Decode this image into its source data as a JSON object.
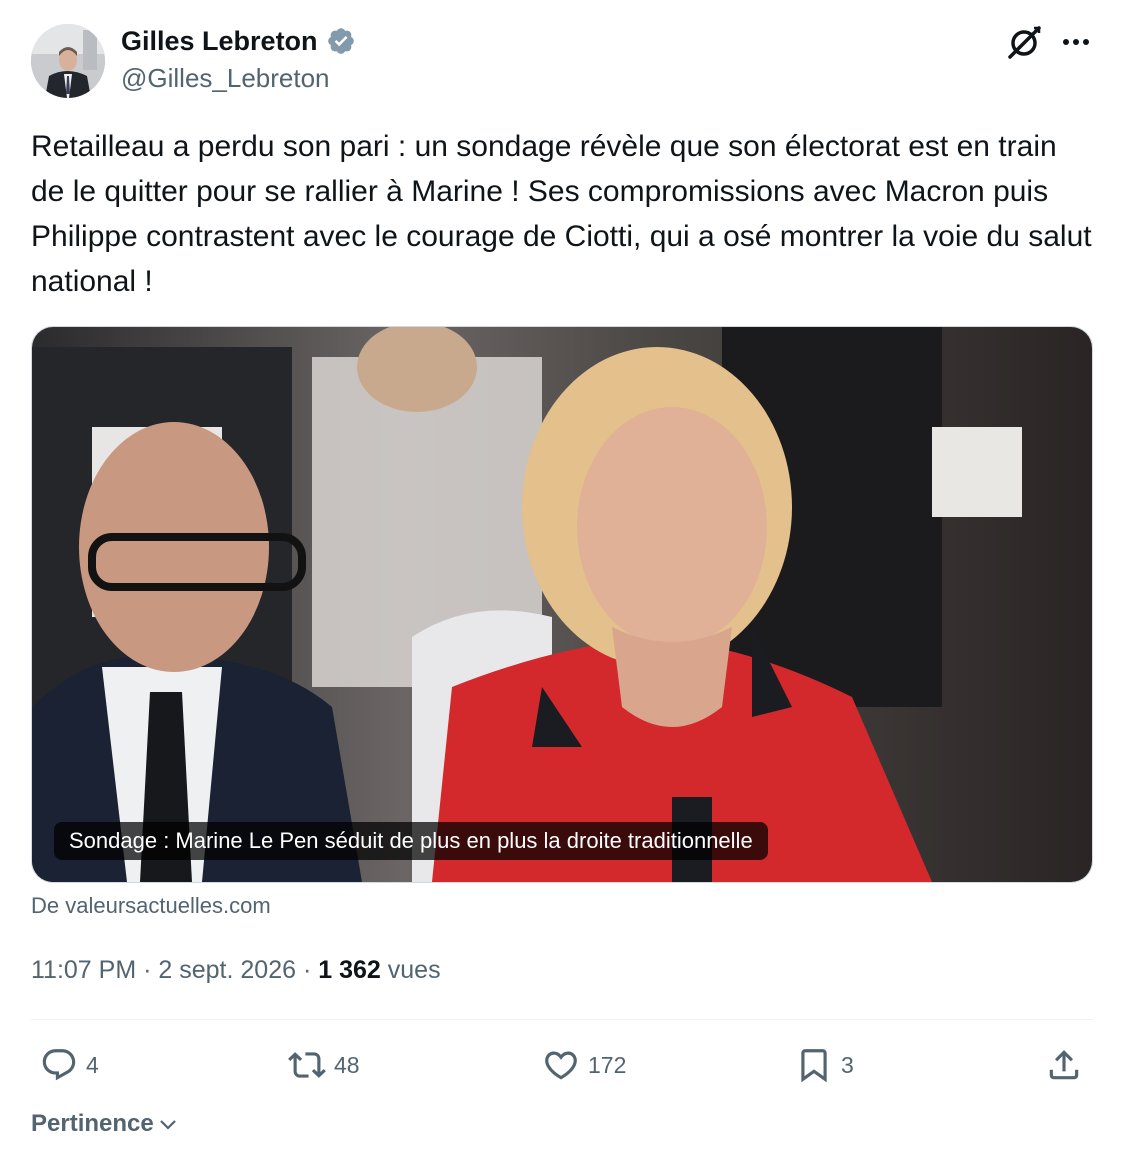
{
  "author": {
    "name": "Gilles Lebreton",
    "handle": "@Gilles_Lebreton"
  },
  "tweet": {
    "text": "Retailleau a perdu son pari : un sondage révèle que son électorat est en train de le quitter pour se rallier à Marine ! Ses compromissions avec Macron puis Philippe contrastent avec le courage de Ciotti, qui a osé montrer la voie du salut national !"
  },
  "card": {
    "caption": "Sondage : Marine Le Pen séduit de plus en plus la droite traditionnelle",
    "source": "De valeursactuelles.com"
  },
  "meta": {
    "time": "11:07 PM",
    "date": "2 sept. 2026",
    "views_count": "1 362",
    "views_label": "vues",
    "separator": "·"
  },
  "actions": {
    "replies": "4",
    "reposts": "48",
    "likes": "172",
    "bookmarks": "3"
  },
  "sort": {
    "label": "Pertinence"
  },
  "colors": {
    "verified": "#829aab",
    "secondary_text": "#536471",
    "primary_text": "#0f1419",
    "divider": "#eff3f4"
  },
  "icons": [
    "verified-badge-icon",
    "grok-icon",
    "more-icon",
    "reply-icon",
    "repost-icon",
    "like-icon",
    "bookmark-icon",
    "share-icon",
    "chevron-down-icon"
  ]
}
